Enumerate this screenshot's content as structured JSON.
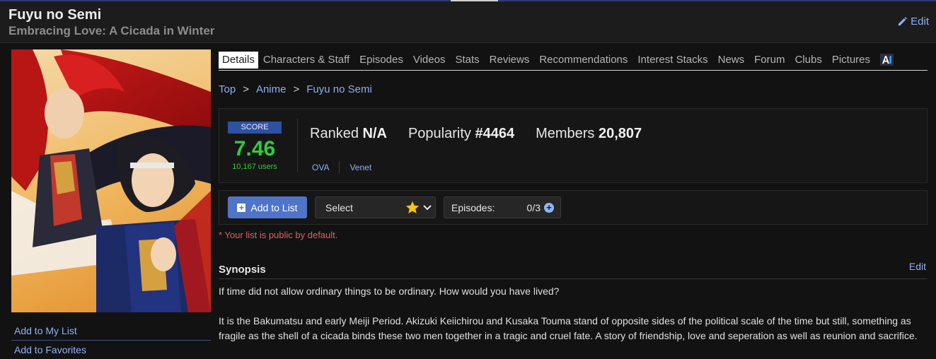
{
  "header": {
    "title": "Fuyu no Semi",
    "subtitle": "Embracing Love: A Cicada in Winter",
    "edit_label": "Edit"
  },
  "sidebar": {
    "links": [
      "Add to My List",
      "Add to Favorites"
    ]
  },
  "tabs": [
    {
      "label": "Details",
      "active": true
    },
    {
      "label": "Characters & Staff"
    },
    {
      "label": "Episodes"
    },
    {
      "label": "Videos"
    },
    {
      "label": "Stats"
    },
    {
      "label": "Reviews"
    },
    {
      "label": "Recommendations"
    },
    {
      "label": "Interest Stacks"
    },
    {
      "label": "News"
    },
    {
      "label": "Forum"
    },
    {
      "label": "Clubs"
    },
    {
      "label": "Pictures"
    }
  ],
  "breadcrumb": {
    "items": [
      "Top",
      "Anime",
      "Fuyu no Semi"
    ],
    "separator": ">"
  },
  "stats": {
    "score_label": "SCORE",
    "score": "7.46",
    "score_users": "10,167 users",
    "ranked_label": "Ranked",
    "ranked_value": "N/A",
    "popularity_label": "Popularity",
    "popularity_value": "#4464",
    "members_label": "Members",
    "members_value": "20,807",
    "type": "OVA",
    "studio": "Venet"
  },
  "list_controls": {
    "add_label": "Add to List",
    "select_value": "Select",
    "episodes_label": "Episodes:",
    "episodes_count": "0/3",
    "public_note": "* Your list is public by default."
  },
  "synopsis": {
    "title": "Synopsis",
    "edit_label": "Edit",
    "paragraphs": [
      "If time did not allow ordinary things to be ordinary. How would you have lived?",
      "It is the Bakumatsu and early Meiji Period. Akizuki Keiichirou and Kusaka Touma stand of opposite sides of the political scale of the time but still, something as fragile as the shell of a cicada binds these two men together in a tragic and cruel fate. A story of friendship, love and seperation as well as reunion and sacrifice."
    ]
  },
  "colors": {
    "accent": "#2e51a2",
    "link": "#8fb3f5",
    "score": "#2ecc40",
    "warning": "#e06060"
  }
}
